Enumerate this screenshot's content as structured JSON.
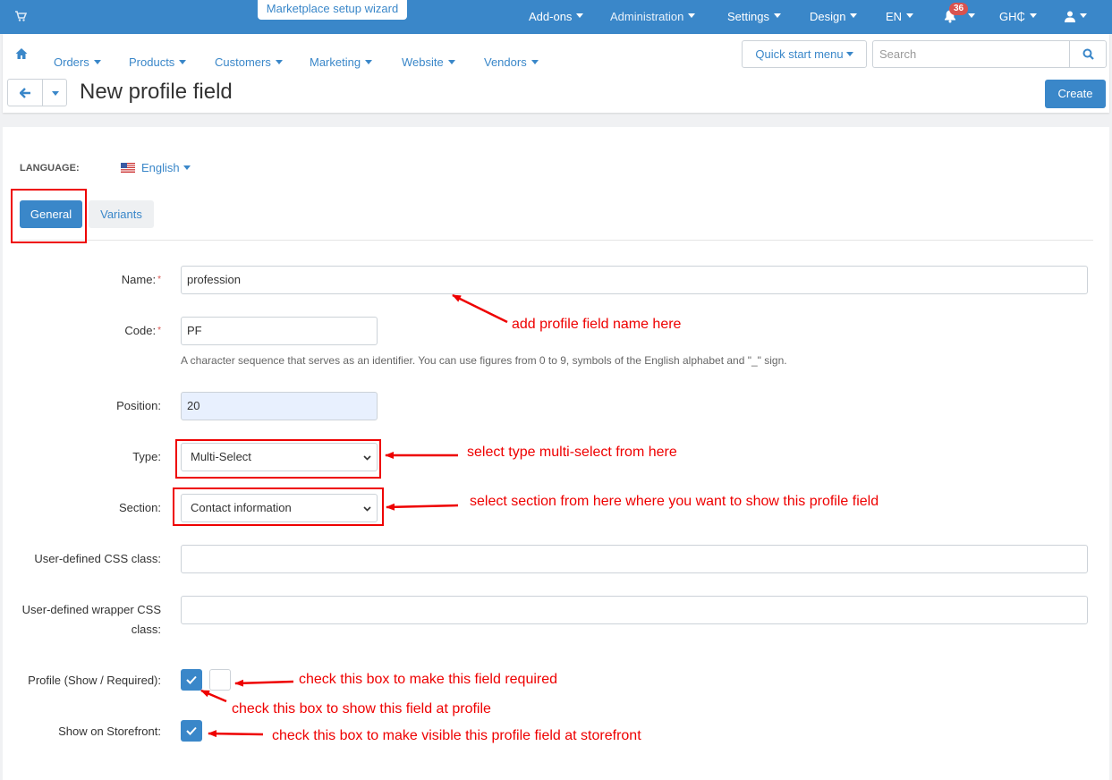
{
  "topbar": {
    "wizard_label": "Marketplace setup wizard",
    "items": [
      {
        "label": "Add-ons"
      },
      {
        "label": "Administration"
      },
      {
        "label": "Settings"
      },
      {
        "label": "Design"
      },
      {
        "label": "EN"
      },
      {
        "label": "GH₵"
      }
    ],
    "notification_count": "36",
    "icons": [
      "cart-icon",
      "bell-icon",
      "user-icon"
    ]
  },
  "nav": {
    "items": [
      {
        "label": "Orders"
      },
      {
        "label": "Products"
      },
      {
        "label": "Customers"
      },
      {
        "label": "Marketing"
      },
      {
        "label": "Website"
      },
      {
        "label": "Vendors"
      }
    ],
    "quick_start_label": "Quick start menu",
    "search_placeholder": "Search"
  },
  "header": {
    "title": "New profile field",
    "create_label": "Create"
  },
  "form": {
    "language_label": "LANGUAGE:",
    "language_value": "English",
    "tabs": [
      {
        "label": "General"
      },
      {
        "label": "Variants"
      }
    ],
    "name_label": "Name:",
    "name_value": "profession",
    "code_label": "Code:",
    "code_value": "PF",
    "code_hint": "A character sequence that serves as an identifier. You can use figures from 0 to 9, symbols of the English alphabet and \"_\" sign.",
    "position_label": "Position:",
    "position_value": "20",
    "type_label": "Type:",
    "type_value": "Multi-Select",
    "section_label": "Section:",
    "section_value": "Contact information",
    "css_class_label": "User-defined CSS class:",
    "css_class_value": "",
    "wrapper_css_label": "User-defined wrapper CSS class:",
    "wrapper_css_value": "",
    "profile_label": "Profile (Show / Required):",
    "profile_show": true,
    "profile_required": false,
    "storefront_label": "Show on Storefront:",
    "storefront_show": true,
    "required_mark": "*"
  },
  "annotations": {
    "name": "add profile field name here",
    "type": "select type multi-select from here",
    "section": "select section from here where you want to show this profile field",
    "required": "check this box to make this field required",
    "show_profile": "check this box to show this field at profile",
    "storefront": "check this box to make visible this profile field at storefront",
    "color": "#ee0000"
  }
}
